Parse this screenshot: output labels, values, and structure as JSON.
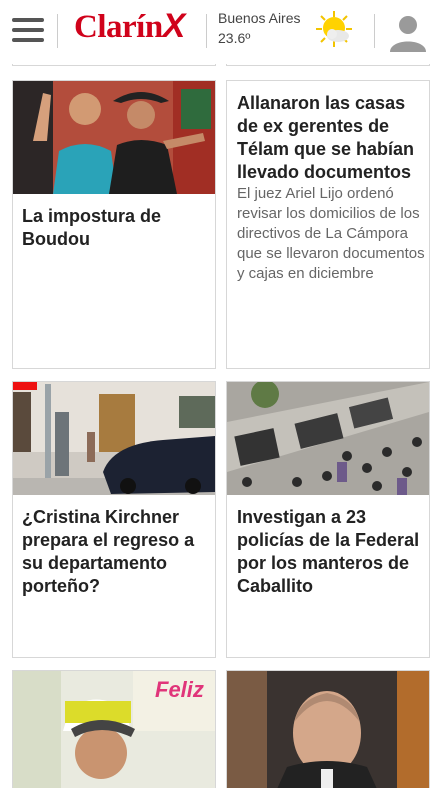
{
  "header": {
    "logo_text": "Clarín",
    "logo_mark": "X",
    "weather_city": "Buenos Aires",
    "weather_temp": "23.6º",
    "menu_icon": "hamburger-icon",
    "weather_icon": "sun-cloud-icon",
    "user_icon": "user-icon"
  },
  "colors": {
    "brand": "#d0021b",
    "text": "#222222",
    "summary": "#666666",
    "border": "#d7d7d7"
  },
  "articles": [
    {
      "headline": "La impostura de Boudou",
      "summary": ""
    },
    {
      "headline": "Allanaron las casas de ex gerentes de Télam que se habían llevado documentos",
      "summary": "El juez Ariel Lijo ordenó revisar los domicilios de los directivos de La Cámpora que se llevaron documentos y cajas en diciembre"
    },
    {
      "headline": "¿Cristina Kirchner prepara el regreso a su departamento porteño?",
      "summary": ""
    },
    {
      "headline": "Investigan a 23 policías de la Federal por los manteros de Caballito",
      "summary": ""
    },
    {
      "headline": "",
      "summary": "",
      "image_text": "Feliz"
    },
    {
      "headline": "",
      "summary": ""
    }
  ]
}
